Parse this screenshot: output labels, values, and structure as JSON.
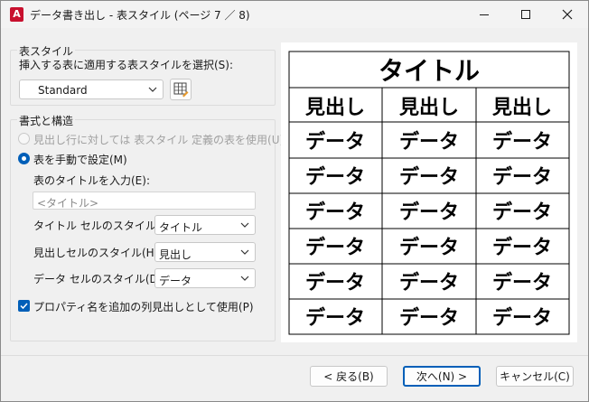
{
  "window": {
    "title": "データ書き出し - 表スタイル (ページ 7 ／ 8)",
    "app_icon_letter": "A"
  },
  "table_style_group": {
    "heading": "表スタイル",
    "prompt": "挿入する表に適用する表スタイルを選択(S):",
    "selected_style": "Standard"
  },
  "format_group": {
    "heading": "書式と構造",
    "option_use_style": "見出し行に対しては 表スタイル 定義の表を使用(U)",
    "option_manual": "表を手動で設定(M)",
    "title_prompt": "表のタイトルを入力(E):",
    "title_placeholder": "<タイトル>",
    "title_cell_label": "タイトル セルのスタイル(T):",
    "title_cell_value": "タイトル",
    "header_cell_label": "見出しセルのスタイル(H):",
    "header_cell_value": "見出し",
    "data_cell_label": "データ セルのスタイル(D):",
    "data_cell_value": "データ",
    "property_checkbox": "プロパティ名を追加の列見出しとして使用(P)"
  },
  "preview": {
    "title": "タイトル",
    "headers": [
      "見出し",
      "見出し",
      "見出し"
    ],
    "rows": [
      [
        "データ",
        "データ",
        "データ"
      ],
      [
        "データ",
        "データ",
        "データ"
      ],
      [
        "データ",
        "データ",
        "データ"
      ],
      [
        "データ",
        "データ",
        "データ"
      ],
      [
        "データ",
        "データ",
        "データ"
      ],
      [
        "データ",
        "データ",
        "データ"
      ]
    ]
  },
  "buttons": {
    "back": "< 戻る(B)",
    "next": "次へ(N) >",
    "cancel": "キャンセル(C)"
  }
}
